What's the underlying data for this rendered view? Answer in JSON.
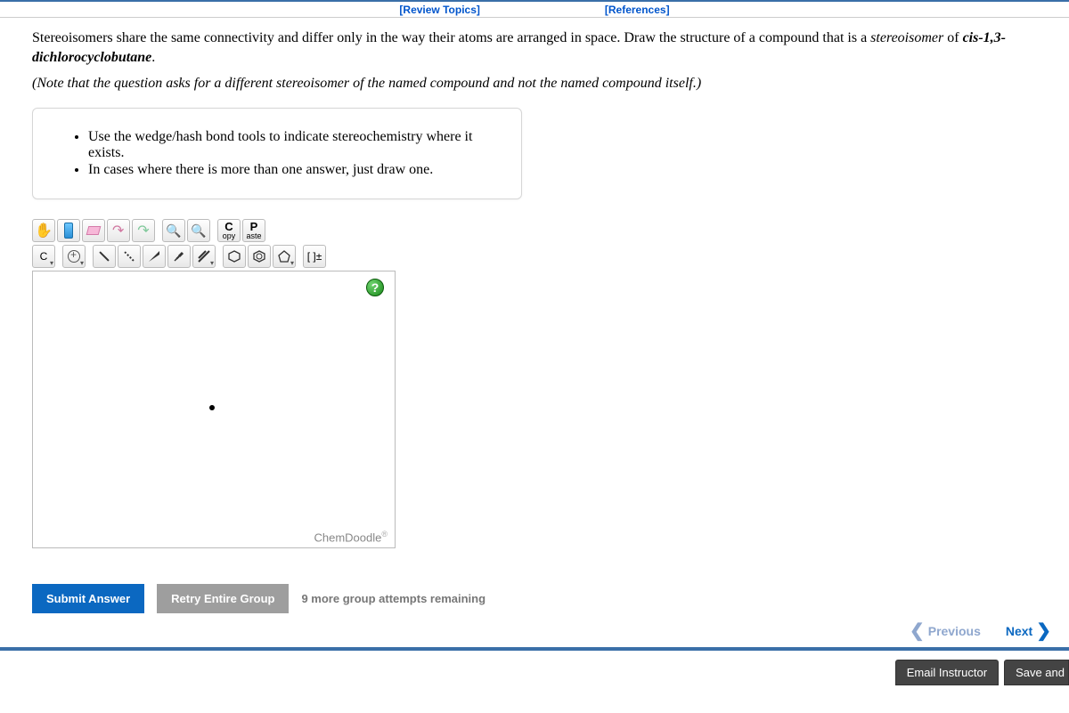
{
  "topbar": {
    "review": "[Review Topics]",
    "references": "[References]"
  },
  "question": {
    "text_a": "Stereoisomers share the same connectivity and differ only in the way their atoms are arranged in space. Draw the structure of a compound that is a ",
    "text_b": "stereoisomer",
    "text_c": " of ",
    "text_d": "cis-1,3-dichlorocyclobutane",
    "text_e": ".",
    "note": "(Note that the question asks for a different stereoisomer of the named compound and not the named compound itself.)"
  },
  "hints": {
    "items": [
      "Use the wedge/hash bond tools to indicate stereochemistry where it exists.",
      "In cases where there is more than one answer, just draw one."
    ]
  },
  "toolbar": {
    "copy_big": "C",
    "copy_small": "opy",
    "paste_big": "P",
    "paste_small": "aste",
    "element": "C",
    "bracket": "[ ]±"
  },
  "canvas": {
    "help": "?",
    "brand": "ChemDoodle",
    "brand_mark": "®"
  },
  "actions": {
    "submit": "Submit Answer",
    "retry": "Retry Entire Group",
    "attempts": "9 more group attempts remaining"
  },
  "nav": {
    "previous": "Previous",
    "next": "Next"
  },
  "footer": {
    "email": "Email Instructor",
    "save": "Save and"
  }
}
